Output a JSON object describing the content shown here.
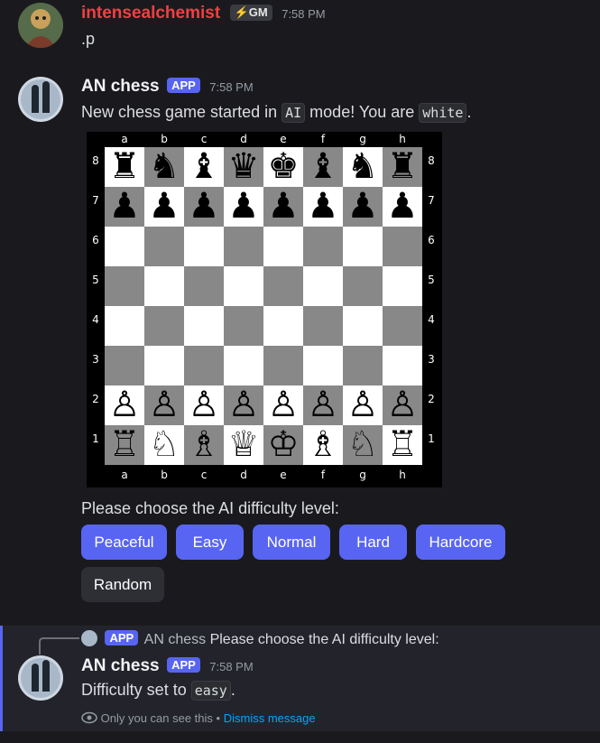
{
  "msg1": {
    "username": "intensealchemist",
    "badge": "⚡GM",
    "time": "7:58 PM",
    "text": ".p"
  },
  "msg2": {
    "username": "AN chess",
    "app_badge": "APP",
    "time": "7:58 PM",
    "text_pre": "New chess game started in ",
    "mode": "AI",
    "text_mid": " mode! You are ",
    "color": "white",
    "text_post": ".",
    "prompt": "Please choose the AI difficulty level:"
  },
  "board": {
    "files": [
      "a",
      "b",
      "c",
      "d",
      "e",
      "f",
      "g",
      "h"
    ],
    "ranks": [
      "8",
      "7",
      "6",
      "5",
      "4",
      "3",
      "2",
      "1"
    ],
    "light_color": "#ffffff",
    "dark_color": "#888888",
    "rows": [
      [
        "♜",
        "♞",
        "♝",
        "♛",
        "♚",
        "♝",
        "♞",
        "♜"
      ],
      [
        "♟",
        "♟",
        "♟",
        "♟",
        "♟",
        "♟",
        "♟",
        "♟"
      ],
      [
        "",
        "",
        "",
        "",
        "",
        "",
        "",
        ""
      ],
      [
        "",
        "",
        "",
        "",
        "",
        "",
        "",
        ""
      ],
      [
        "",
        "",
        "",
        "",
        "",
        "",
        "",
        ""
      ],
      [
        "",
        "",
        "",
        "",
        "",
        "",
        "",
        ""
      ],
      [
        "♙",
        "♙",
        "♙",
        "♙",
        "♙",
        "♙",
        "♙",
        "♙"
      ],
      [
        "♖",
        "♘",
        "♗",
        "♕",
        "♔",
        "♗",
        "♘",
        "♖"
      ]
    ]
  },
  "buttons": {
    "peaceful": "Peaceful",
    "easy": "Easy",
    "normal": "Normal",
    "hard": "Hard",
    "hardcore": "Hardcore",
    "random": "Random"
  },
  "reply": {
    "ref_badge": "APP",
    "ref_name": "AN chess",
    "ref_text": "Please choose the AI difficulty level:",
    "username": "AN chess",
    "app_badge": "APP",
    "time": "7:58 PM",
    "text_pre": "Difficulty set to ",
    "difficulty": "easy",
    "text_post": ".",
    "ephemeral_note": "Only you can see this",
    "separator": "•",
    "dismiss": "Dismiss message"
  },
  "colors": {
    "accent": "#5865f2",
    "username_red": "#f23f42",
    "link": "#00a8fc"
  }
}
